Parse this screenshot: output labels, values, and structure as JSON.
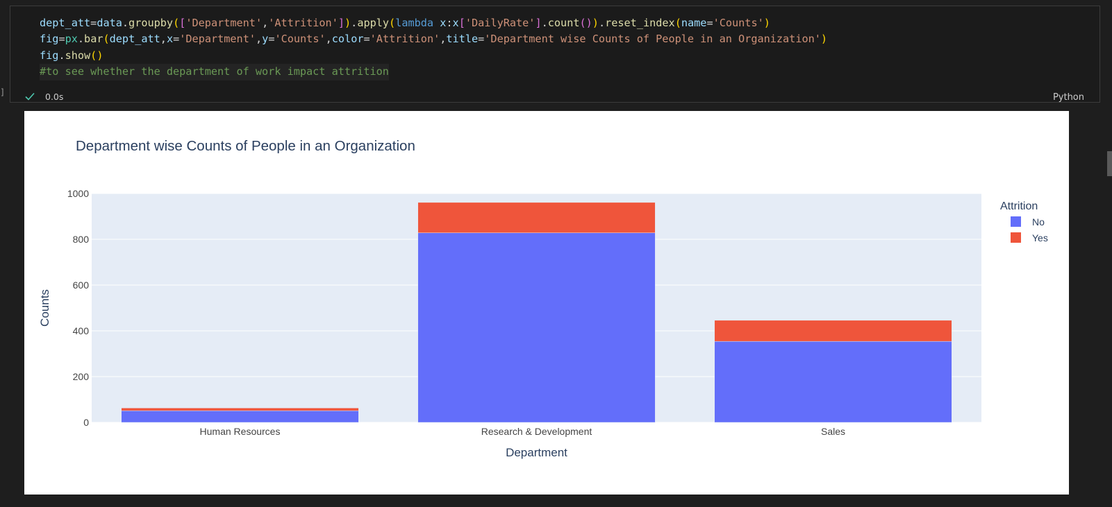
{
  "cell": {
    "code_lines": [
      [
        {
          "t": "dept_att",
          "c": "t-var"
        },
        {
          "t": "=",
          "c": "t-p"
        },
        {
          "t": "data",
          "c": "t-var"
        },
        {
          "t": ".",
          "c": "t-p"
        },
        {
          "t": "groupby",
          "c": "t-fn"
        },
        {
          "t": "(",
          "c": "t-br1"
        },
        {
          "t": "[",
          "c": "t-br2"
        },
        {
          "t": "'Department'",
          "c": "t-str"
        },
        {
          "t": ",",
          "c": "t-p"
        },
        {
          "t": "'Attrition'",
          "c": "t-str"
        },
        {
          "t": "]",
          "c": "t-br2"
        },
        {
          "t": ")",
          "c": "t-br1"
        },
        {
          "t": ".",
          "c": "t-p"
        },
        {
          "t": "apply",
          "c": "t-fn"
        },
        {
          "t": "(",
          "c": "t-br1"
        },
        {
          "t": "lambda",
          "c": "t-kw"
        },
        {
          "t": " ",
          "c": "t-p"
        },
        {
          "t": "x",
          "c": "t-var"
        },
        {
          "t": ":",
          "c": "t-p"
        },
        {
          "t": "x",
          "c": "t-var"
        },
        {
          "t": "[",
          "c": "t-br2"
        },
        {
          "t": "'DailyRate'",
          "c": "t-str"
        },
        {
          "t": "]",
          "c": "t-br2"
        },
        {
          "t": ".",
          "c": "t-p"
        },
        {
          "t": "count",
          "c": "t-fn"
        },
        {
          "t": "(",
          "c": "t-br2"
        },
        {
          "t": ")",
          "c": "t-br2"
        },
        {
          "t": ")",
          "c": "t-br1"
        },
        {
          "t": ".",
          "c": "t-p"
        },
        {
          "t": "reset_index",
          "c": "t-fn"
        },
        {
          "t": "(",
          "c": "t-br1"
        },
        {
          "t": "name",
          "c": "t-var"
        },
        {
          "t": "=",
          "c": "t-p"
        },
        {
          "t": "'Counts'",
          "c": "t-str"
        },
        {
          "t": ")",
          "c": "t-br1"
        }
      ],
      [
        {
          "t": "fig",
          "c": "t-var"
        },
        {
          "t": "=",
          "c": "t-p"
        },
        {
          "t": "px",
          "c": "t-mod"
        },
        {
          "t": ".",
          "c": "t-p"
        },
        {
          "t": "bar",
          "c": "t-fn"
        },
        {
          "t": "(",
          "c": "t-br1"
        },
        {
          "t": "dept_att",
          "c": "t-var"
        },
        {
          "t": ",",
          "c": "t-p"
        },
        {
          "t": "x",
          "c": "t-var"
        },
        {
          "t": "=",
          "c": "t-p"
        },
        {
          "t": "'Department'",
          "c": "t-str"
        },
        {
          "t": ",",
          "c": "t-p"
        },
        {
          "t": "y",
          "c": "t-var"
        },
        {
          "t": "=",
          "c": "t-p"
        },
        {
          "t": "'Counts'",
          "c": "t-str"
        },
        {
          "t": ",",
          "c": "t-p"
        },
        {
          "t": "color",
          "c": "t-var"
        },
        {
          "t": "=",
          "c": "t-p"
        },
        {
          "t": "'Attrition'",
          "c": "t-str"
        },
        {
          "t": ",",
          "c": "t-p"
        },
        {
          "t": "title",
          "c": "t-var"
        },
        {
          "t": "=",
          "c": "t-p"
        },
        {
          "t": "'Department wise Counts of People in an Organization'",
          "c": "t-str"
        },
        {
          "t": ")",
          "c": "t-br1"
        }
      ],
      [
        {
          "t": "fig",
          "c": "t-var"
        },
        {
          "t": ".",
          "c": "t-p"
        },
        {
          "t": "show",
          "c": "t-fn"
        },
        {
          "t": "()",
          "c": "t-br1"
        }
      ],
      [
        {
          "t": "#to see whether the department of work impact attrition",
          "c": "t-com"
        }
      ]
    ],
    "exec_time": "0.0s",
    "language": "Python",
    "status_icon": "check-icon",
    "status_color": "#4ec9b0"
  },
  "chart_data": {
    "type": "bar",
    "barmode": "stack",
    "title": "Department wise Counts of People in an Organization",
    "xlabel": "Department",
    "ylabel": "Counts",
    "ylim": [
      0,
      1000
    ],
    "yticks": [
      0,
      200,
      400,
      600,
      800,
      1000
    ],
    "categories": [
      "Human Resources",
      "Research & Development",
      "Sales"
    ],
    "series": [
      {
        "name": "No",
        "values": [
          51,
          828,
          354
        ],
        "color": "#636efa"
      },
      {
        "name": "Yes",
        "values": [
          12,
          133,
          92
        ],
        "color": "#ef553b"
      }
    ],
    "legend": {
      "title": "Attrition",
      "position": "top-right"
    },
    "grid": true,
    "plot_bg": "#e5ecf6"
  }
}
